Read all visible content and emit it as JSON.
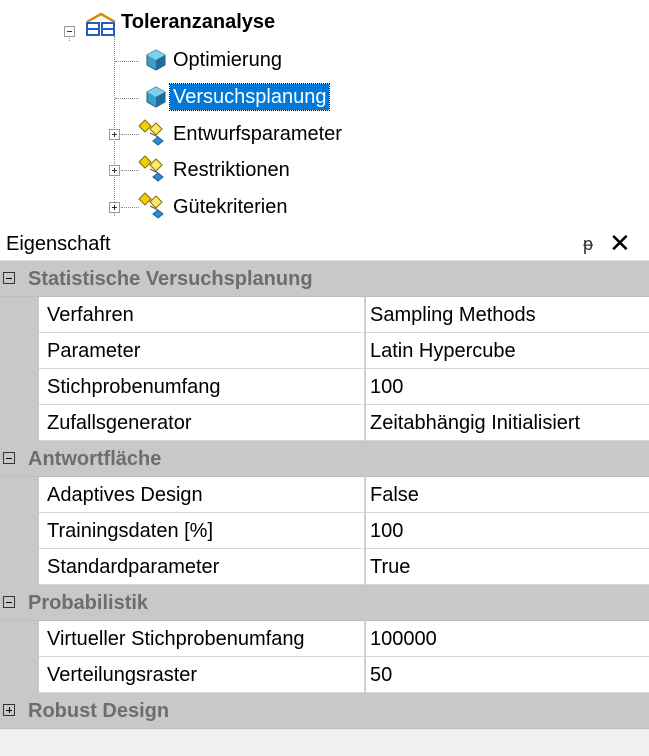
{
  "tree": {
    "root": {
      "label": "Toleranzanalyse"
    },
    "items": [
      {
        "label": "Optimierung"
      },
      {
        "label": "Versuchsplanung",
        "selected": true
      },
      {
        "label": "Entwurfsparameter"
      },
      {
        "label": "Restriktionen"
      },
      {
        "label": "Gütekriterien"
      }
    ],
    "selection_color": "#0078d7"
  },
  "panel": {
    "title": "Eigenschaft",
    "pin_glyph": "ᵽ",
    "close_glyph": "✕"
  },
  "grid": {
    "categories": [
      {
        "name": "Statistische Versuchsplanung",
        "expanded": true,
        "rows": [
          {
            "name": "Verfahren",
            "value": "Sampling Methods"
          },
          {
            "name": "Parameter",
            "value": "Latin Hypercube"
          },
          {
            "name": "Stichprobenumfang",
            "value": "100"
          },
          {
            "name": "Zufallsgenerator",
            "value": "Zeitabhängig Initialisiert"
          }
        ]
      },
      {
        "name": "Antwortfläche",
        "expanded": true,
        "rows": [
          {
            "name": "Adaptives Design",
            "value": "False"
          },
          {
            "name": "Trainingsdaten [%]",
            "value": "100"
          },
          {
            "name": "Standardparameter",
            "value": "True"
          }
        ]
      },
      {
        "name": "Probabilistik",
        "expanded": true,
        "rows": [
          {
            "name": "Virtueller Stichprobenumfang",
            "value": "100000"
          },
          {
            "name": "Verteilungsraster",
            "value": "50"
          }
        ]
      },
      {
        "name": "Robust Design",
        "expanded": false,
        "rows": []
      }
    ]
  }
}
